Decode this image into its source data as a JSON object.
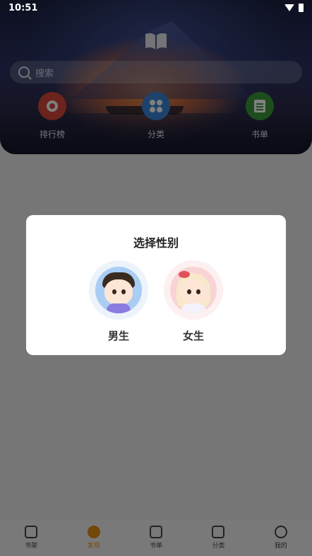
{
  "status": {
    "time": "10:51"
  },
  "search": {
    "placeholder": "搜索"
  },
  "quick_links": [
    {
      "label": "排行榜",
      "icon": "ranking-medal-icon",
      "color": "#d9473c"
    },
    {
      "label": "分类",
      "icon": "category-clover-icon",
      "color": "#3a84d8"
    },
    {
      "label": "书单",
      "icon": "booklist-doc-icon",
      "color": "#3b9b3b"
    }
  ],
  "dialog": {
    "title": "选择性别",
    "options": [
      {
        "label": "男生",
        "avatar": "boy-avatar-icon"
      },
      {
        "label": "女生",
        "avatar": "girl-avatar-icon"
      }
    ]
  },
  "bottom_nav": [
    {
      "label": "书架",
      "icon": "bookshelf-icon",
      "active": false
    },
    {
      "label": "发现",
      "icon": "compass-icon",
      "active": true
    },
    {
      "label": "书单",
      "icon": "booklist-icon",
      "active": false
    },
    {
      "label": "分类",
      "icon": "layers-icon",
      "active": false
    },
    {
      "label": "我的",
      "icon": "settings-gear-icon",
      "active": false
    }
  ],
  "colors": {
    "accent": "#e59212"
  }
}
